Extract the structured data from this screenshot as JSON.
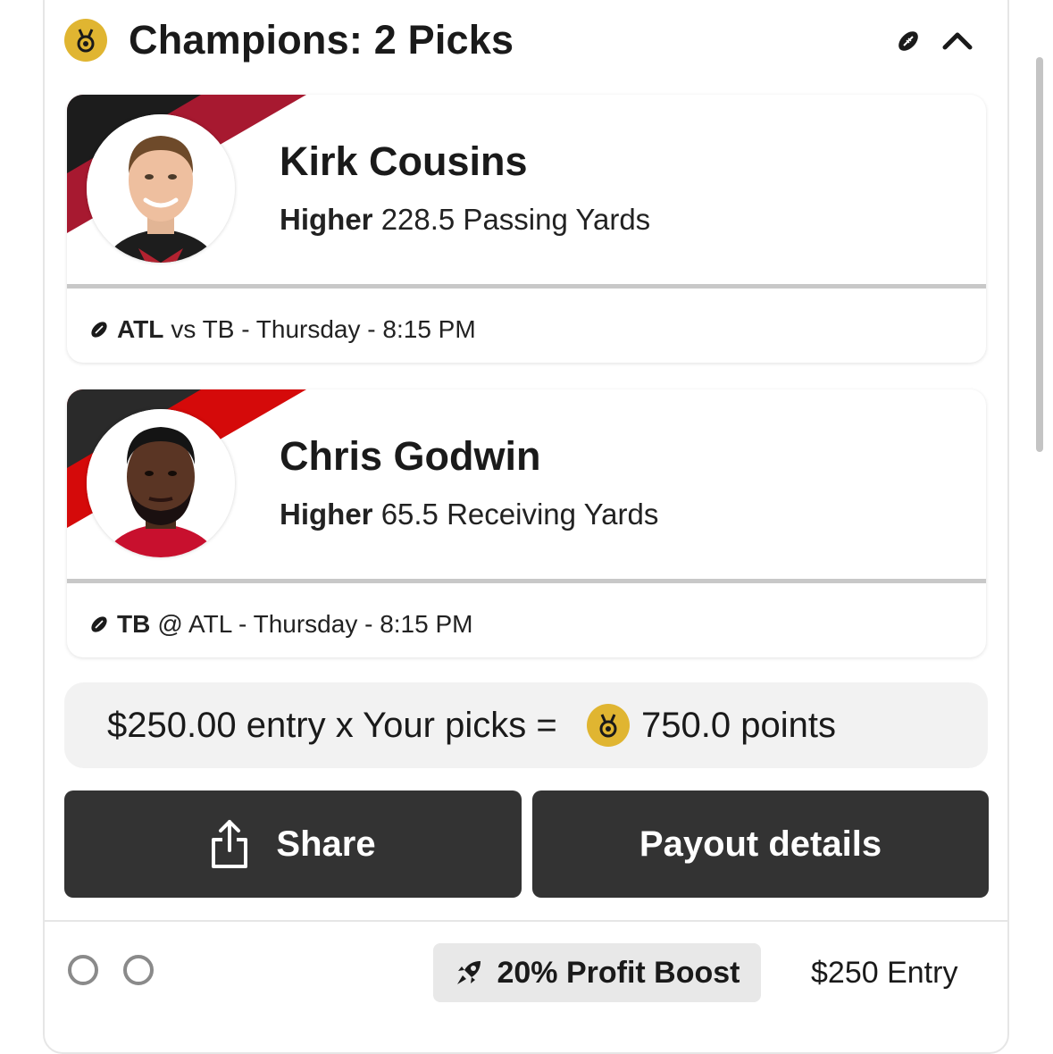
{
  "header": {
    "title": "Champions: 2 Picks",
    "icons": [
      "medal-icon",
      "football-icon",
      "chevron-up-icon"
    ]
  },
  "picks": [
    {
      "player": "Kirk Cousins",
      "direction": "Higher",
      "line": "228.5 Passing Yards",
      "team": "ATL",
      "matchup": "vs TB - Thursday - 8:15 PM",
      "stripe_colors": [
        "#1c1c1c",
        "#a71930"
      ]
    },
    {
      "player": "Chris Godwin",
      "direction": "Higher",
      "line": "65.5 Receiving Yards",
      "team": "TB",
      "matchup": "@ ATL - Thursday - 8:15 PM",
      "stripe_colors": [
        "#2a2a2a",
        "#d50a0a"
      ]
    }
  ],
  "summary": {
    "text": "$250.00 entry x Your picks =",
    "points": "750.0 points"
  },
  "buttons": {
    "share": "Share",
    "payout": "Payout details"
  },
  "footer": {
    "boost": "20% Profit Boost",
    "entry": "$250 Entry"
  },
  "colors": {
    "medal": "#e0b531",
    "button_bg": "#333333",
    "summary_bg": "#f2f2f2"
  }
}
